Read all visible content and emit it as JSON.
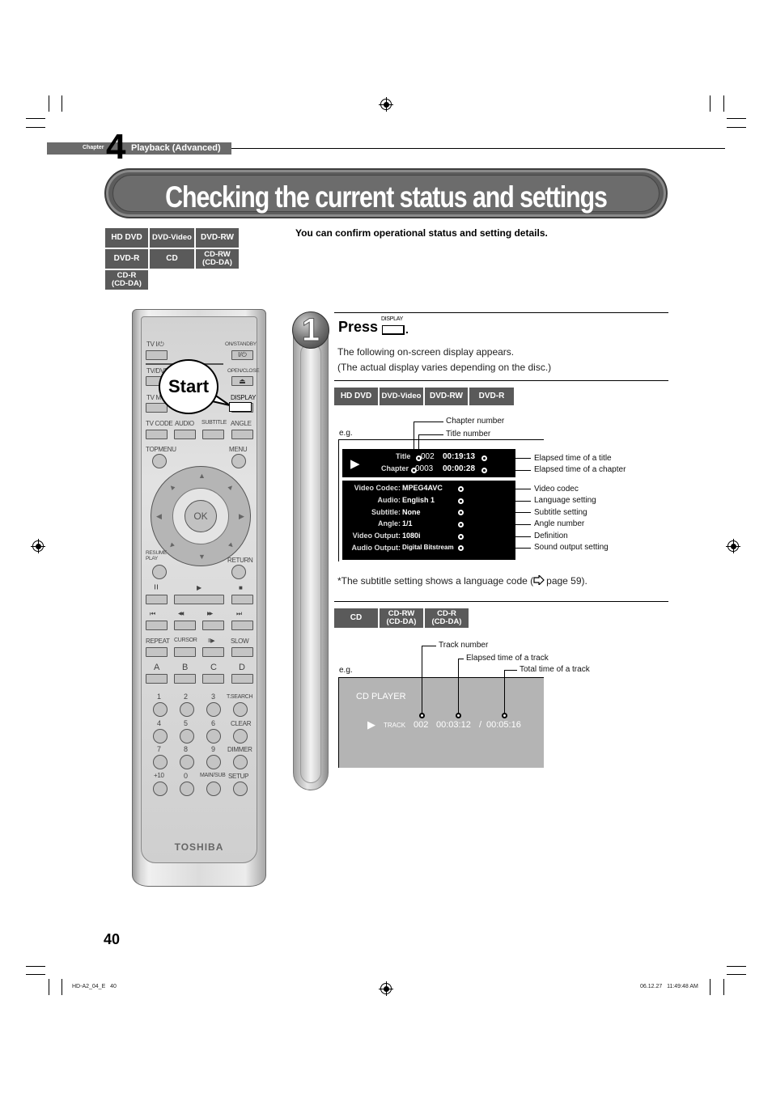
{
  "header": {
    "chapter_word": "Chapter",
    "chapter_number": "4",
    "chapter_title": "Playback (Advanced)"
  },
  "title": "Checking the current status and settings",
  "intro": "You can confirm operational status and setting details.",
  "disc_badges_top": [
    {
      "label": "HD DVD"
    },
    {
      "label": "DVD-Video"
    },
    {
      "label": "DVD-RW"
    },
    {
      "label": "DVD-R"
    },
    {
      "label": "CD"
    },
    {
      "label": "CD-RW\n(CD-DA)"
    },
    {
      "label": "CD-R\n(CD-DA)"
    }
  ],
  "remote": {
    "callout": "Start",
    "brand": "TOSHIBA",
    "labels": {
      "tv_power": "TV I/⏻",
      "on_standby": "ON/STANDBY",
      "power_glyph": "I/⏻",
      "tv_dvd": "TV/DVD",
      "open_close": "OPEN/CLOSE",
      "eject_glyph": "⏏",
      "tv_mode": "TV MODE",
      "display": "DISPLAY",
      "tv_code": "TV CODE",
      "audio": "AUDIO",
      "subtitle": "SUBTITLE",
      "angle": "ANGLE",
      "topmenu": "TOPMENU",
      "menu": "MENU",
      "ok": "OK",
      "resume_play": "RESUME\nPLAY",
      "return": "RETURN",
      "pause_glyph": "❙❙",
      "play_glyph": "▶",
      "stop_glyph": "■",
      "prev_glyph": "⏮",
      "rew_glyph": "◀◀",
      "ff_glyph": "▶▶",
      "next_glyph": "⏭",
      "repeat": "REPEAT",
      "cursor": "CURSOR",
      "step_glyph": "II▶",
      "slow": "SLOW",
      "a": "A",
      "b": "B",
      "c": "C",
      "d": "D",
      "n1": "1",
      "n2": "2",
      "n3": "3",
      "tsearch": "T.SEARCH",
      "n4": "4",
      "n5": "5",
      "n6": "6",
      "clear": "CLEAR",
      "n7": "7",
      "n8": "8",
      "n9": "9",
      "dimmer": "DIMMER",
      "plus10": "+10",
      "n0": "0",
      "mainsub": "MAIN/SUB",
      "setup": "SETUP"
    }
  },
  "step1": {
    "number": "1",
    "press": "Press",
    "button_label": "DISPLAY",
    "period": ".",
    "line1": "The following on-screen display appears.",
    "line2": "(The actual display varies depending on the disc.)"
  },
  "dvd_section": {
    "badges": [
      "HD DVD",
      "DVD-Video",
      "DVD-RW",
      "DVD-R"
    ],
    "eg": "e.g.",
    "osd": {
      "play_glyph": "▶",
      "title_label": "Title",
      "title_number": "002",
      "title_time": "00:19:13",
      "chapter_label": "Chapter",
      "chapter_number": "0003",
      "chapter_time": "00:00:28",
      "rows": [
        {
          "key": "Video Codec:",
          "value": "MPEG4AVC"
        },
        {
          "key": "Audio:",
          "value": "English 1"
        },
        {
          "key": "Subtitle:",
          "value": "None"
        },
        {
          "key": "Angle:",
          "value": "1/1"
        },
        {
          "key": "Video Output:",
          "value": "1080i"
        },
        {
          "key": "Audio Output:",
          "value": "Digital Bitstream"
        }
      ]
    },
    "annotations": {
      "chapter_number": "Chapter number",
      "title_number": "Title number",
      "elapsed_title": "Elapsed time of a title",
      "elapsed_chapter": "Elapsed time of a chapter",
      "rows": [
        "Video codec",
        "Language setting",
        "Subtitle setting",
        "Angle number",
        "Definition",
        "Sound output setting"
      ]
    },
    "footnote_pre": "*The subtitle setting shows a language code (",
    "footnote_ref": "page 59).",
    "ref_icon": "arrow-right"
  },
  "cd_section": {
    "badges": [
      "CD",
      "CD-RW\n(CD-DA)",
      "CD-R\n(CD-DA)"
    ],
    "eg": "e.g.",
    "screen_title": "CD PLAYER",
    "play_glyph": "▶",
    "track_label": "TRACK",
    "track_number": "002",
    "elapsed": "00:03:12",
    "separator": "/",
    "total": "00:05:16",
    "annotations": {
      "track_number": "Track number",
      "elapsed": "Elapsed time of a track",
      "total": "Total time of a track"
    }
  },
  "footer": {
    "page_number": "40",
    "file_id": "HD-A2_04_E   40",
    "timestamp": "06.12.27   11:49:48 AM"
  }
}
